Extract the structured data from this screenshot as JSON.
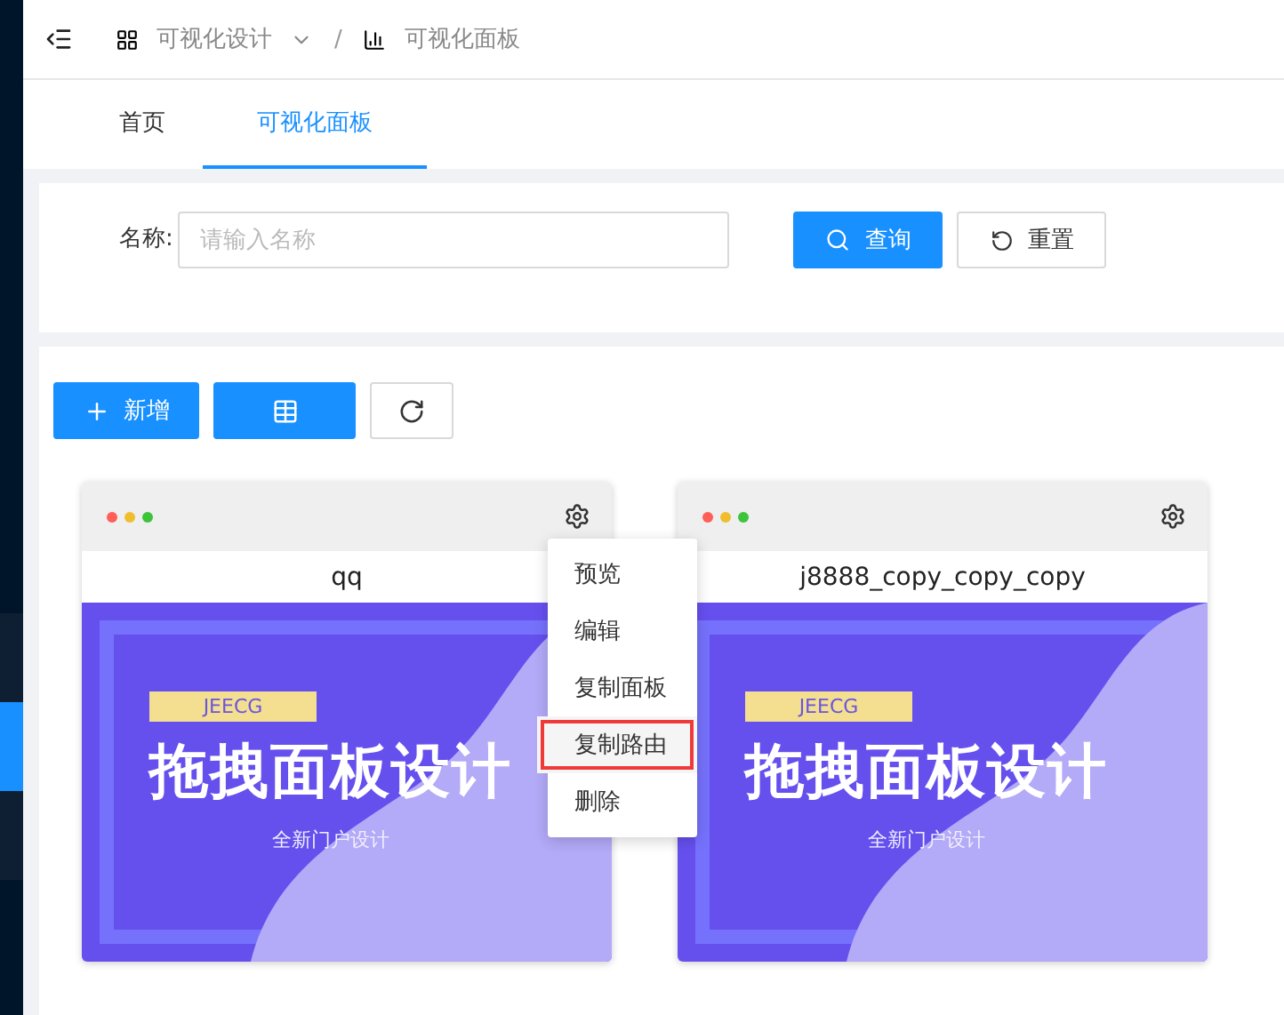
{
  "sidebar": [
    {
      "selected": false
    },
    {
      "selected": true
    },
    {
      "selected": false
    }
  ],
  "breadcrumb": [
    {
      "label": "可视化设计",
      "dropdown": true
    },
    {
      "label": "可视化面板",
      "dropdown": false
    }
  ],
  "breadcrumb_separator": "/",
  "tabs": [
    {
      "label": "首页",
      "selected": false
    },
    {
      "label": "可视化面板",
      "selected": true
    }
  ],
  "search": {
    "label": "名称:",
    "placeholder": "请输入名称",
    "buttons": [
      {
        "label": "查询",
        "kind": "primary"
      },
      {
        "label": "重置",
        "kind": "default"
      }
    ]
  },
  "toolbar": [
    {
      "label": "新增",
      "kind": "primary"
    },
    {
      "kind": "primary"
    },
    {
      "kind": "default"
    }
  ],
  "cards": [
    {
      "title": "qq",
      "cover": {
        "tag": "JEECG",
        "heading": "拖拽面板设计",
        "subtitle": "全新门户设计"
      }
    },
    {
      "title": "j8888_copy_copy_copy",
      "cover": {
        "tag": "JEECG",
        "heading": "拖拽面板设计",
        "subtitle": "全新门户设计"
      }
    }
  ],
  "card_menu": {
    "items": [
      {
        "label": "预览",
        "highlighted": false
      },
      {
        "label": "编辑",
        "highlighted": false
      },
      {
        "label": "复制面板",
        "highlighted": false
      },
      {
        "label": "复制路由",
        "highlighted": true
      },
      {
        "label": "删除",
        "highlighted": false
      }
    ]
  }
}
